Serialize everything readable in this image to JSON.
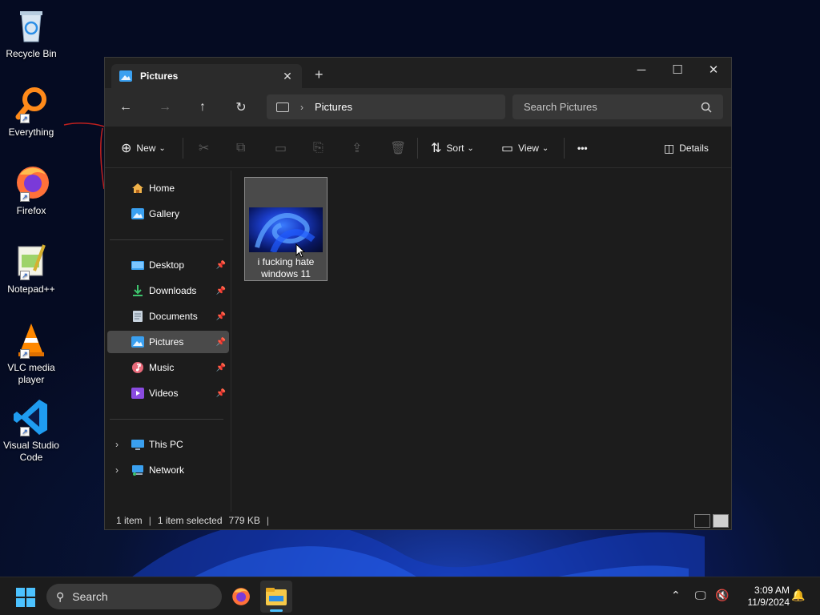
{
  "desktop": {
    "icons": [
      {
        "label": "Recycle Bin"
      },
      {
        "label": "Everything"
      },
      {
        "label": "Firefox"
      },
      {
        "label": "Notepad++"
      },
      {
        "label": "VLC media player"
      },
      {
        "label": "Visual Studio Code"
      }
    ]
  },
  "window": {
    "tab_title": "Pictures",
    "breadcrumb": "Pictures",
    "search_placeholder": "Search Pictures",
    "toolbar": {
      "new_label": "New",
      "sort_label": "Sort",
      "view_label": "View",
      "more_label": "•••",
      "details_label": "Details"
    },
    "sidebar": {
      "quick": [
        {
          "label": "Home"
        },
        {
          "label": "Gallery"
        }
      ],
      "pinned": [
        {
          "label": "Desktop"
        },
        {
          "label": "Downloads"
        },
        {
          "label": "Documents"
        },
        {
          "label": "Pictures",
          "selected": true
        },
        {
          "label": "Music"
        },
        {
          "label": "Videos"
        }
      ],
      "locations": [
        {
          "label": "This PC"
        },
        {
          "label": "Network"
        }
      ]
    },
    "files": [
      {
        "name": "i fucking hate windows 11",
        "selected": true
      }
    ],
    "status": {
      "count": "1 item",
      "selection": "1 item selected",
      "size": "779 KB"
    }
  },
  "taskbar": {
    "search_label": "Search",
    "time": "3:09 AM",
    "date": "11/9/2024"
  },
  "colors": {
    "accent": "#4cc2ff",
    "window_bg": "#1c1c1c",
    "navbar_bg": "#2b2b2b",
    "selection": "#4a4a4a"
  }
}
